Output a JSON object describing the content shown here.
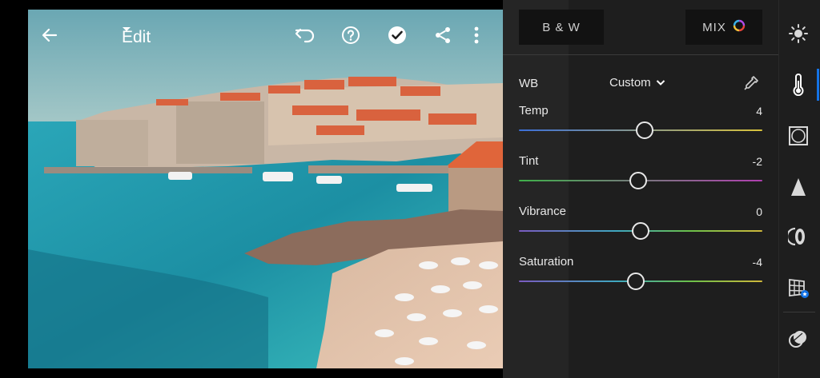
{
  "toolbar": {
    "edit_label": "Edit",
    "icons": [
      "back-arrow-icon",
      "chevron-down-icon",
      "undo-icon",
      "help-icon",
      "checkmark-icon",
      "share-icon",
      "more-vertical-icon"
    ]
  },
  "panel": {
    "bw_label": "B & W",
    "mix_label": "MIX",
    "wb": {
      "label": "WB",
      "preset": "Custom"
    },
    "sliders": [
      {
        "key": "temp",
        "label": "Temp",
        "value": "4",
        "position": 0.518
      },
      {
        "key": "tint",
        "label": "Tint",
        "value": "-2",
        "position": 0.49
      },
      {
        "key": "vibrance",
        "label": "Vibrance",
        "value": "0",
        "position": 0.5
      },
      {
        "key": "saturation",
        "label": "Saturation",
        "value": "-4",
        "position": 0.48
      }
    ]
  },
  "rail": {
    "icons": [
      "light-icon",
      "color-thermometer-icon",
      "effects-vignette-icon",
      "detail-triangle-icon",
      "optics-lens-icon",
      "geometry-grid-icon",
      "presets-icon"
    ],
    "active": "color-thermometer-icon"
  },
  "colors": {
    "panel_bg": "#1e1e1e",
    "accent": "#1473e6",
    "text": "#e8e8e8"
  }
}
